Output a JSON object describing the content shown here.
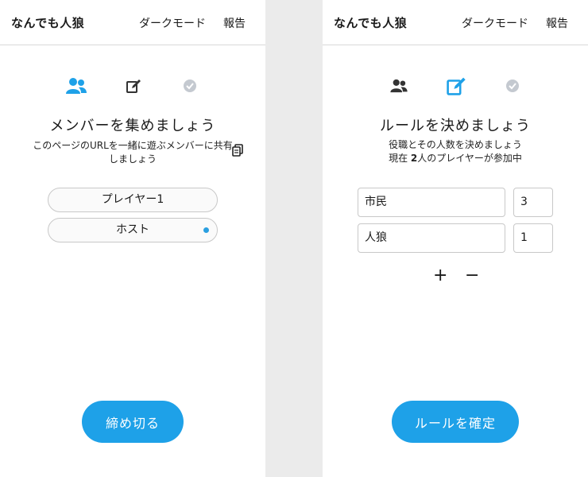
{
  "left": {
    "header": {
      "brand": "なんでも人狼",
      "dark_mode": "ダークモード",
      "report": "報告"
    },
    "step_icons": [
      "users-icon",
      "edit-icon",
      "check-circle-icon"
    ],
    "title": "メンバーを集めましょう",
    "subtitle_line1": "このページのURLを一緒に遊ぶメンバーに共有",
    "subtitle_line2": "しましょう",
    "members": [
      "プレイヤー1",
      "ホスト"
    ],
    "close_button": "締め切る"
  },
  "right": {
    "header": {
      "brand": "なんでも人狼",
      "dark_mode": "ダークモード",
      "report": "報告"
    },
    "step_icons": [
      "users-icon",
      "edit-icon",
      "check-circle-icon"
    ],
    "title": "ルールを決めましょう",
    "subtitle_line1": "役職とその人数を決めましょう",
    "subtitle_prefix": "現在 ",
    "player_count": "2",
    "subtitle_suffix": "人のプレイヤーが参加中",
    "roles": [
      {
        "name": "市民",
        "count": "3"
      },
      {
        "name": "人狼",
        "count": "1"
      }
    ],
    "add_label": "+",
    "remove_label": "−",
    "confirm_button": "ルールを確定"
  },
  "colors": {
    "accent": "#1ea1e8",
    "inactive_icon": "#333333",
    "done_icon": "#c4c9d0"
  }
}
